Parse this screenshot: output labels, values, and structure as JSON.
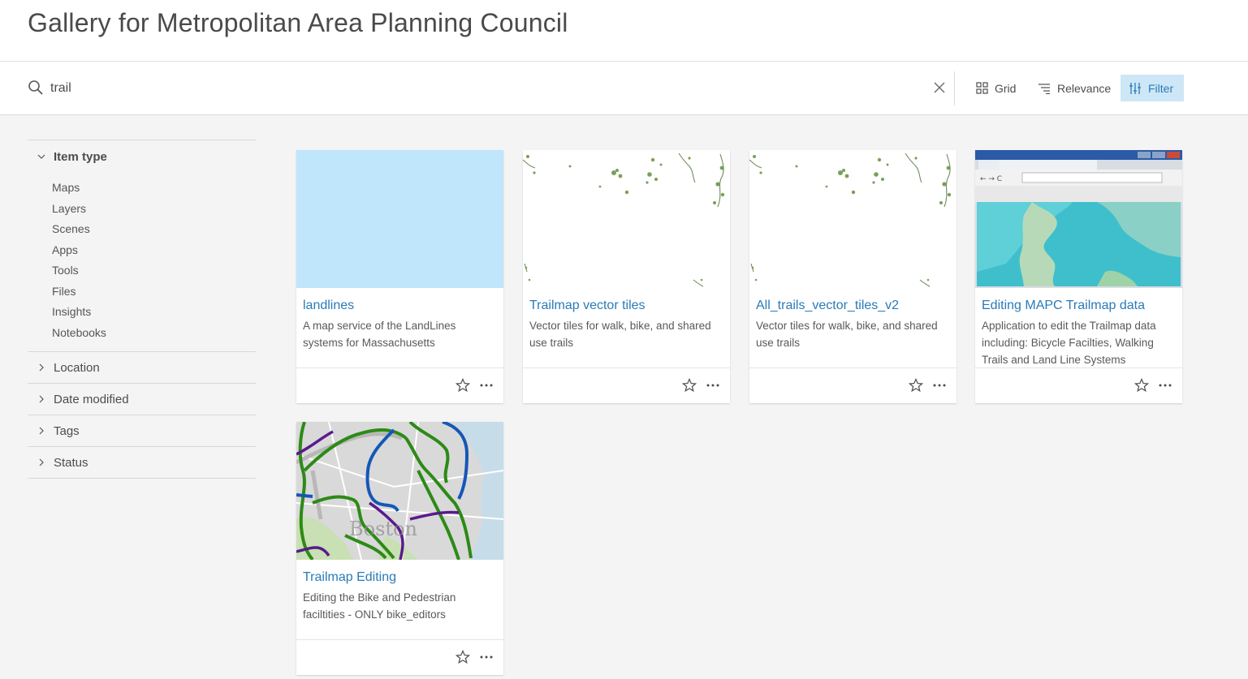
{
  "header": {
    "title": "Gallery for Metropolitan Area Planning Council"
  },
  "search": {
    "value": "trail"
  },
  "toolbar": {
    "grid_label": "Grid",
    "relevance_label": "Relevance",
    "filter_label": "Filter"
  },
  "sidebar": {
    "item_type": {
      "label": "Item type",
      "items": [
        "Maps",
        "Layers",
        "Scenes",
        "Apps",
        "Tools",
        "Files",
        "Insights",
        "Notebooks"
      ]
    },
    "facets": [
      "Location",
      "Date modified",
      "Tags",
      "Status"
    ]
  },
  "cards": [
    {
      "title": "landlines",
      "description": "A map service of the LandLines systems for Massachusetts"
    },
    {
      "title": "Trailmap vector tiles",
      "description": "Vector tiles for walk, bike, and shared use trails"
    },
    {
      "title": "All_trails_vector_tiles_v2",
      "description": "Vector tiles for walk, bike, and shared use trails"
    },
    {
      "title": "Editing MAPC Trailmap data",
      "description": "Application to edit the Trailmap data including: Bicycle Facilties, Walking Trails and Land Line Systems"
    },
    {
      "title": "Trailmap Editing",
      "description": "Editing the Bike and Pedestrian faciltities - ONLY bike_editors"
    }
  ],
  "colors": {
    "accent": "#2a7bb8",
    "filter_active_bg": "#cde7f6",
    "light_blue_thumb": "#bfe6fb"
  }
}
